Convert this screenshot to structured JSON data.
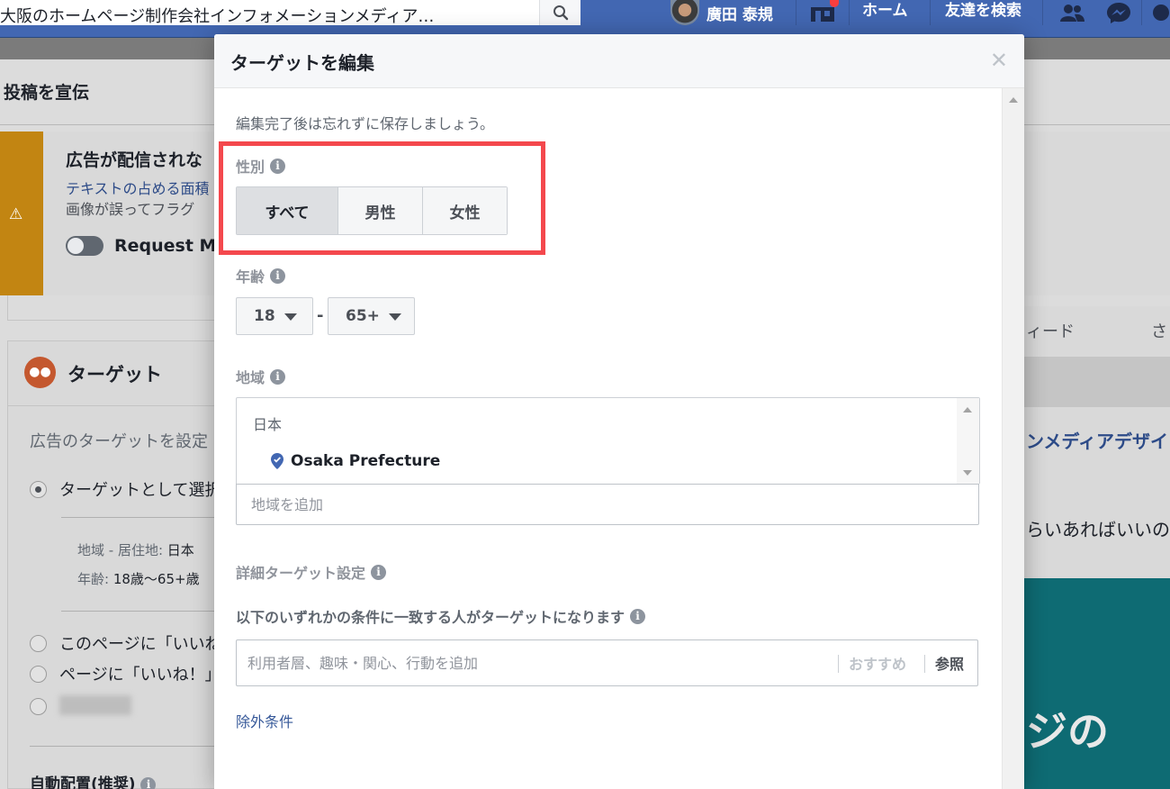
{
  "topbar": {
    "search_text": "大阪のホームページ制作会社インフォメーションメディア…",
    "user_name": "廣田 泰規",
    "home_label": "ホーム",
    "find_friends_label": "友達を検索"
  },
  "background": {
    "page_title": "投稿を宣伝",
    "warning": {
      "title": "広告が配信されな",
      "link": "テキストの占める面積",
      "text": "画像が誤ってフラグ",
      "toggle_label": "Request Ma"
    },
    "target_card": {
      "title": "ターゲット",
      "desc": "広告のターゲットを設定",
      "options": [
        "ターゲットとして選択",
        "このページに「いいね",
        "ページに「いいね！」"
      ],
      "details": [
        {
          "label": "地域 - 居住地:",
          "value": "日本"
        },
        {
          "label": "年齢:",
          "value": "18歳〜65+歳"
        }
      ],
      "auto_placement": "自動配置(推奨)"
    },
    "right": {
      "feed_label": "ィード",
      "feed_label2": "さ",
      "page_name": "ンメディアデザイ",
      "text": "らいあればいいの",
      "image_text": "ジの"
    }
  },
  "modal": {
    "title": "ターゲットを編集",
    "hint": "編集完了後は忘れずに保存しましょう。",
    "gender": {
      "label": "性別",
      "options": [
        "すべて",
        "男性",
        "女性"
      ],
      "selected": "すべて"
    },
    "age": {
      "label": "年齢",
      "min": "18",
      "max": "65+"
    },
    "location": {
      "label": "地域",
      "country": "日本",
      "items": [
        "Osaka Prefecture"
      ],
      "add_placeholder": "地域を追加"
    },
    "detailed": {
      "label": "詳細ターゲット設定",
      "sub_label": "以下のいずれかの条件に一致する人がターゲットになります",
      "input_placeholder": "利用者層、趣味・関心、行動を追加",
      "suggest_label": "おすすめ",
      "browse_label": "参照",
      "exclude_link": "除外条件"
    }
  },
  "colors": {
    "facebook_blue": "#4267b2",
    "highlight_red": "#f4484d",
    "warning_orange": "#c28512",
    "link_blue": "#365899"
  }
}
